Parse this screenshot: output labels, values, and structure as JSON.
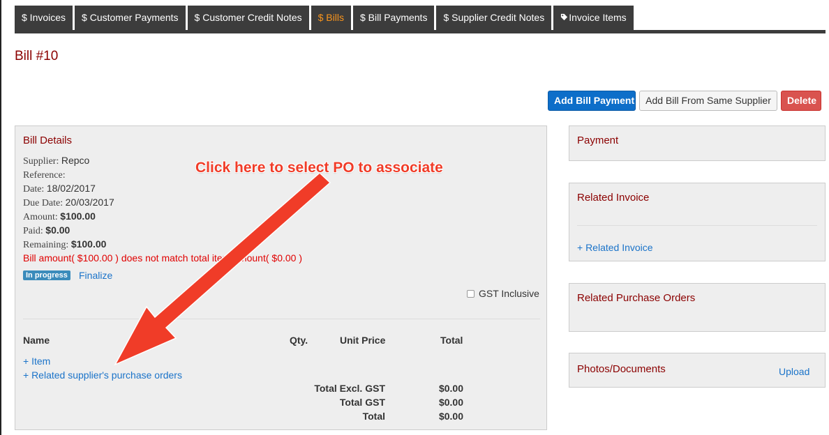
{
  "tabs": [
    {
      "label": "$ Invoices",
      "active": false
    },
    {
      "label": "$ Customer Payments",
      "active": false
    },
    {
      "label": "$ Customer Credit Notes",
      "active": false
    },
    {
      "label": "$ Bills",
      "active": true
    },
    {
      "label": "$ Bill Payments",
      "active": false
    },
    {
      "label": "$ Supplier Credit Notes",
      "active": false
    },
    {
      "label": "Invoice Items",
      "active": false,
      "icon": "tag-icon"
    }
  ],
  "page_title": "Bill #10",
  "actions": {
    "add_bill_payment": "Add Bill Payment",
    "add_bill_same_supplier": "Add Bill From Same Supplier",
    "delete": "Delete"
  },
  "bill_details": {
    "title": "Bill Details",
    "supplier_label": "Supplier:",
    "supplier": "Repco",
    "reference_label": "Reference:",
    "reference": "",
    "date_label": "Date:",
    "date": "18/02/2017",
    "due_date_label": "Due Date:",
    "due_date": "20/03/2017",
    "amount_label": "Amount:",
    "amount": "$100.00",
    "paid_label": "Paid:",
    "paid": "$0.00",
    "remaining_label": "Remaining:",
    "remaining": "$100.00",
    "warning": "Bill amount( $100.00 ) does not match total item amount( $0.00 )",
    "status_badge": "In progress",
    "finalize_link": "Finalize",
    "gst_inclusive_label": "GST Inclusive",
    "gst_inclusive_checked": false,
    "table_headers": {
      "name": "Name",
      "qty": "Qty.",
      "unit_price": "Unit Price",
      "total": "Total"
    },
    "add_item_link": "+ Item",
    "related_po_link": "+ Related supplier's purchase orders",
    "totals": [
      {
        "label": "Total Excl. GST",
        "value": "$0.00"
      },
      {
        "label": "Total GST",
        "value": "$0.00"
      },
      {
        "label": "Total",
        "value": "$0.00"
      }
    ]
  },
  "side_panels": {
    "payment_title": "Payment",
    "related_invoice_title": "Related Invoice",
    "related_invoice_link": "+ Related Invoice",
    "related_po_title": "Related Purchase Orders",
    "photos_title": "Photos/Documents",
    "upload_link": "Upload"
  },
  "annotation": {
    "text": "Click here to select PO to associate",
    "color": "#f03c28"
  },
  "colors": {
    "accent_tab": "#f7941d",
    "title_red": "#8b0000",
    "link_blue": "#1a73c9",
    "primary_button": "#0d6ec9",
    "danger_button": "#d9534f"
  }
}
